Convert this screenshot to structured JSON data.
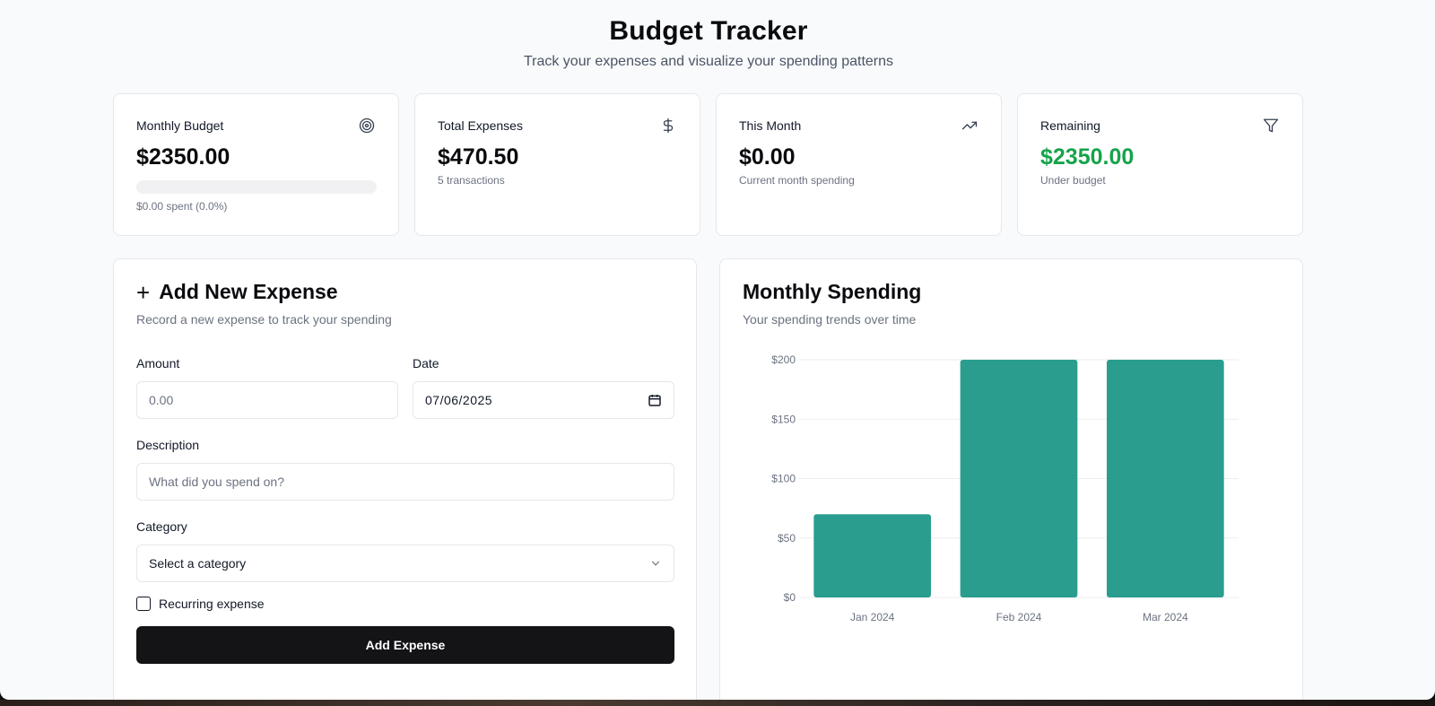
{
  "header": {
    "title": "Budget Tracker",
    "subtitle": "Track your expenses and visualize your spending patterns"
  },
  "stats": {
    "monthly_budget": {
      "title": "Monthly Budget",
      "value": "$2350.00",
      "progress_fraction": 0.0,
      "sub": "$0.00 spent (0.0%)",
      "icon": "target-icon"
    },
    "total_expenses": {
      "title": "Total Expenses",
      "value": "$470.50",
      "sub": "5 transactions",
      "icon": "dollar-icon"
    },
    "this_month": {
      "title": "This Month",
      "value": "$0.00",
      "sub": "Current month spending",
      "icon": "trending-up-icon"
    },
    "remaining": {
      "title": "Remaining",
      "value": "$2350.00",
      "sub": "Under budget",
      "icon": "filter-icon",
      "value_color": "#16a34a"
    }
  },
  "form": {
    "title": "Add New Expense",
    "subtitle": "Record a new expense to track your spending",
    "amount_label": "Amount",
    "amount_placeholder": "0.00",
    "date_label": "Date",
    "date_value": "07/06/2025",
    "description_label": "Description",
    "description_placeholder": "What did you spend on?",
    "category_label": "Category",
    "category_value": "Select a category",
    "recurring_label": "Recurring expense",
    "recurring_checked": false,
    "submit_label": "Add Expense"
  },
  "chart_panel": {
    "title": "Monthly Spending",
    "subtitle": "Your spending trends over time"
  },
  "chart_data": {
    "type": "bar",
    "categories": [
      "Jan 2024",
      "Feb 2024",
      "Mar 2024"
    ],
    "values": [
      70,
      200,
      200
    ],
    "y_ticks": [
      0,
      50,
      100,
      150,
      200
    ],
    "y_tick_labels": [
      "$0",
      "$50",
      "$100",
      "$150",
      "$200"
    ],
    "ylim": [
      0,
      200
    ],
    "grid": true,
    "bar_color": "#2a9d8f"
  }
}
